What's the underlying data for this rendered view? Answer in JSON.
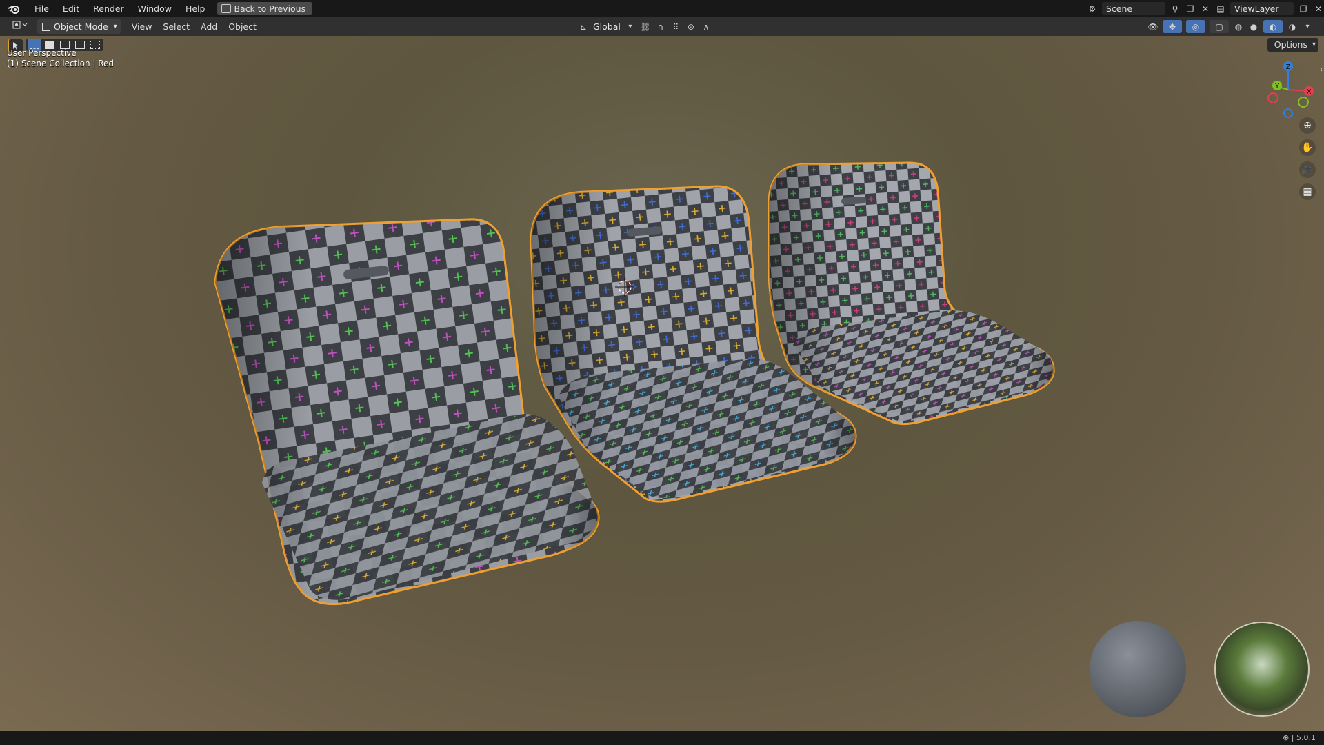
{
  "menu": {
    "file": "File",
    "edit": "Edit",
    "render": "Render",
    "window": "Window",
    "help": "Help",
    "back_to_previous": "Back to Previous"
  },
  "topbar": {
    "scene": "Scene",
    "view_layer": "ViewLayer"
  },
  "header": {
    "mode": "Object Mode",
    "view": "View",
    "select": "Select",
    "add": "Add",
    "object": "Object",
    "orientation": "Global"
  },
  "viewport": {
    "perspective": "User Perspective",
    "collection": "(1) Scene Collection | Red",
    "options": "Options",
    "gizmo_labels": {
      "z": "Z",
      "y": "Y",
      "x": "X"
    }
  },
  "statusbar": {
    "version": "5.0.1"
  },
  "colors": {
    "selection_outline": "#f0a030",
    "active_tool": "#4772b3",
    "axis_x": "#e04050",
    "axis_y": "#80c020",
    "axis_z": "#3080e0"
  },
  "icons": [
    "blender-logo-icon",
    "zoom-icon",
    "hand-pan-icon",
    "camera-icon",
    "grid-icon"
  ]
}
